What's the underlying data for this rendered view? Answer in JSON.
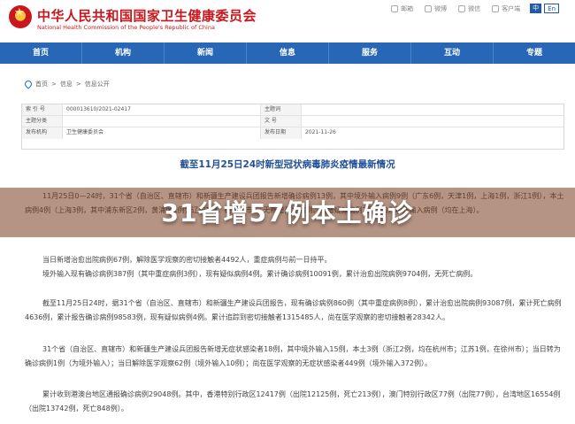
{
  "header": {
    "title_cn": "中华人民共和国国家卫生健康委员会",
    "title_en": "National Health Commission of the People's Republic of China",
    "links": [
      {
        "label": "邮箱",
        "icon": "mail-icon"
      },
      {
        "label": "微博",
        "icon": "weibo-icon"
      },
      {
        "label": "微信",
        "icon": "wechat-icon"
      },
      {
        "label": "客户端",
        "icon": "mobile-icon"
      }
    ],
    "lang_cn": "中",
    "lang_en": "En"
  },
  "nav": [
    "首页",
    "机构",
    "新闻",
    "信息",
    "服务",
    "互动",
    "专题"
  ],
  "breadcrumb": [
    "首页",
    "信息",
    "信息公开"
  ],
  "meta": {
    "rows": [
      {
        "label1": "索 引 号",
        "value1": "000013610/2021-02417",
        "label2": "主题词",
        "value2": ""
      },
      {
        "label1": "主题分类",
        "value1": "",
        "label2": "文 号",
        "value2": ""
      },
      {
        "label1": "发布机构",
        "value1": "卫生健康委员会",
        "label2": "发布日期",
        "value2": "2021-11-26"
      }
    ]
  },
  "article": {
    "title": "截至11月25日24时新型冠状病毒肺炎疫情最新情况",
    "paragraphs": [
      "11月25日0—24时，31个省（自治区、直辖市）和新疆生产建设兵团报告新增确诊病例13例，其中境外输入病例9例（广东6例，天津1例，上海1例，浙江1例），本土病例4例（上海3例，其中浦东新区2例，黄浦区1例；辽宁1例，在大连市）。无新增死亡病例。新增疑似病例2例，均为境外输入病例（均在上海）。",
      "当日新增治愈出院病例67例，解除医学观察的密切接触者4492人，重症病例与前一日持平。",
      "境外输入现有确诊病例387例（其中重症病例3例），现有疑似病例4例。累计确诊病例10091例，累计治愈出院病例9704例，无死亡病例。",
      "截至11月25日24时，据31个省（自治区、直辖市）和新疆生产建设兵团报告，现有确诊病例860例（其中重症病例8例），累计治愈出院病例93087例，累计死亡病例4636例，累计报告确诊病例98583例，现有疑似病例4例。累计追踪到密切接触者1315485人，尚在医学观察的密切接触者28342人。",
      "31个省（自治区、直辖市）和新疆生产建设兵团报告新增无症状感染者18例，其中境外输入15例，本土3例（浙江2例，均在杭州市；江苏1例，在徐州市）；当日转为确诊病例1例（为境外输入）；当日解除医学观察62例（境外输入10例）；尚在医学观察的无症状感染者449例（境外输入372例）。",
      "累计收到港澳台地区通报确诊病例29048例。其中，香港特别行政区12417例（出院12125例，死亡213例），澳门特别行政区77例（出院77例），台湾地区16554例（出院13742例，死亡848例）。"
    ]
  },
  "overlay": {
    "text": "31省增57例本土确诊"
  }
}
